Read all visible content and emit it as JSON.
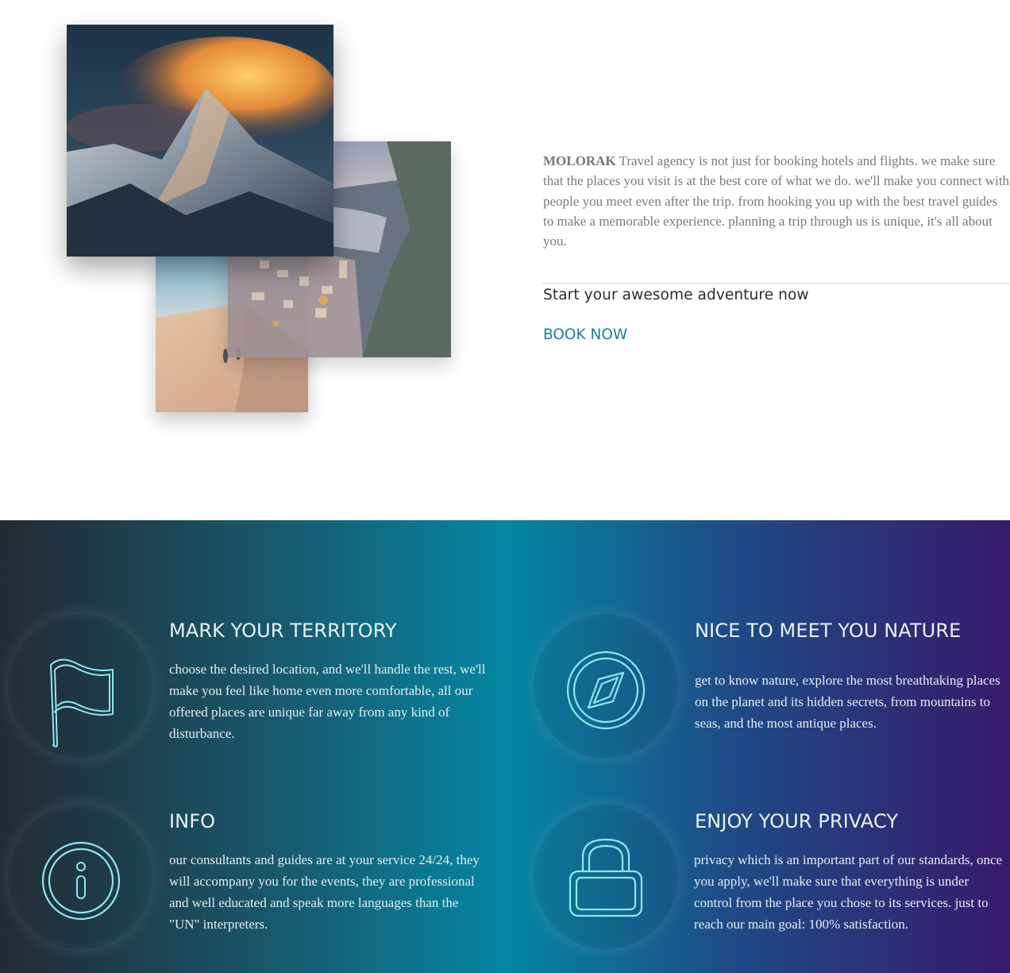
{
  "about": {
    "brand": "MOLORAK",
    "description": " Travel agency is not just for booking hotels and flights. we make sure that the places you visit is at the best core of what we do. we'll make you connect with people you meet even after the trip. from hooking you up with the best travel guides to make a memorable experience. planning a trip through us is unique, it's all about you.",
    "tagline": "Start your awesome adventure now",
    "cta_label": "BOOK NOW"
  },
  "features": [
    {
      "title": "MARK YOUR TERRITORY",
      "text": "choose the desired location, and we'll handle the rest, we'll make you feel like home even more comfortable, all our offered places are unique far away from any kind of disturbance.",
      "icon": "flag-icon"
    },
    {
      "title": "NICE TO MEET YOU NATURE",
      "text": "get to know nature, explore the most breathtaking places on the planet and its hidden secrets, from mountains to seas, and the most antique places.",
      "icon": "compass-icon"
    },
    {
      "title": "INFO",
      "text": "our consultants and guides are at your service 24/24, they will accompany you for the events, they are professional and well educated and speak more languages than the \"UN\" interpreters.",
      "icon": "info-icon"
    },
    {
      "title": "ENJOY YOUR PRIVACY",
      "text": "privacy which is an important part of our standards, once you apply, we'll make sure that everything is under control from the place you chose to its services. just to reach our main goal: 100% satisfaction.",
      "icon": "lock-icon"
    }
  ],
  "colors": {
    "accent": "#1a7f9e",
    "icon_stroke": "#8fe6f0",
    "gradient": [
      "#232a33",
      "#185a6e",
      "#0586a2",
      "#1f4c86",
      "#381a6b"
    ]
  }
}
